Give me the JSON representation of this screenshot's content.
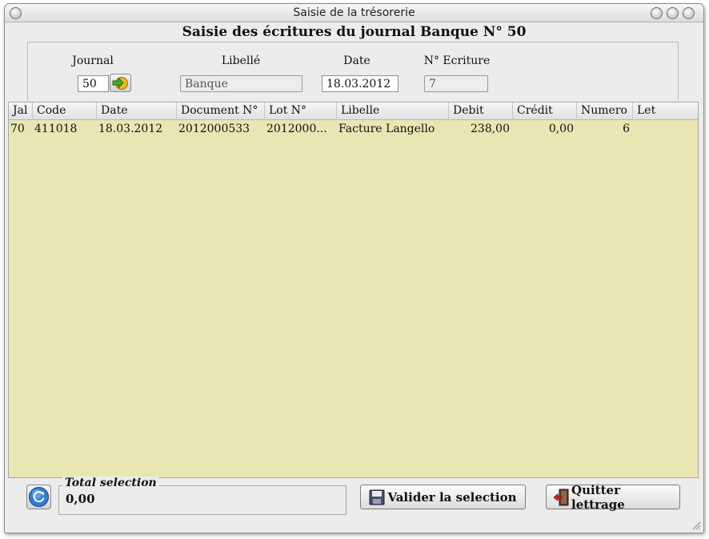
{
  "window": {
    "title": "Saisie de la trésorerie"
  },
  "heading": "Saisie des écritures du journal Banque N° 50",
  "form": {
    "journal_label": "Journal",
    "journal_value": "50",
    "libelle_label": "Libellé",
    "libelle_value": "Banque",
    "date_label": "Date",
    "date_value": "18.03.2012",
    "ecriture_label": "N° Ecriture",
    "ecriture_value": "7"
  },
  "table": {
    "columns": [
      "Jal",
      "Code",
      "Date",
      "Document N°",
      "Lot N°",
      "Libelle",
      "Debit",
      "Crédit",
      "Numero",
      "Let"
    ],
    "rows": [
      [
        "70",
        "411018",
        "18.03.2012",
        "2012000533",
        "2012000...",
        "Facture Langello",
        "238,00",
        "0,00",
        "6",
        ""
      ]
    ]
  },
  "footer": {
    "total_label": "Total selection",
    "total_value": "0,00",
    "validate_button": "Valider la selection",
    "quit_button": "Quitter lettrage"
  },
  "icons": {
    "refresh": "refresh-icon",
    "go": "arrow-right-icon",
    "save": "floppy-disk-icon",
    "exit": "exit-door-icon"
  },
  "colors": {
    "grid_background": "#e9e6b3",
    "window_background": "#ececec"
  }
}
